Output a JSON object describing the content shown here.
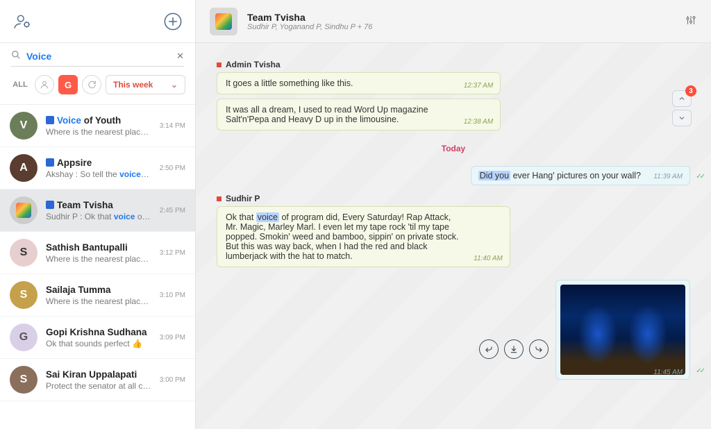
{
  "search": {
    "query": "Voice"
  },
  "filters": {
    "all_label": "ALL",
    "g_label": "G",
    "date_label": "This week"
  },
  "chats": [
    {
      "title_pre": "",
      "title_hl": "Voice",
      "title_post": " of Youth",
      "preview": "Where is the nearest place to...",
      "time": "3:14 PM",
      "group": true
    },
    {
      "title_pre": "Appsire",
      "title_hl": "",
      "title_post": "",
      "preview_pre": "Akshay  : So tell the ",
      "preview_hl": "voice",
      "preview_post": " of...",
      "time": "2:50 PM",
      "group": true
    },
    {
      "title_pre": "Team Tvisha",
      "title_hl": "",
      "title_post": "",
      "preview_pre": "Sudhir P  : Ok that ",
      "preview_hl": "voice",
      "preview_post": " of p...",
      "time": "2:45 PM",
      "group": true,
      "selected": true
    },
    {
      "title_pre": "Sathish Bantupalli",
      "preview": "Where is the nearest place to...",
      "time": "3:12 PM"
    },
    {
      "title_pre": "Sailaja Tumma",
      "preview": "Where is the nearest place to...",
      "time": "3:10 PM"
    },
    {
      "title_pre": "Gopi Krishna Sudhana",
      "preview": "Ok that sounds perfect  👍",
      "time": "3:09 PM"
    },
    {
      "title_pre": "Sai Kiran Uppalapati",
      "preview": "Protect the senator at all costs.",
      "time": "3:00 PM"
    }
  ],
  "header": {
    "group_name": "Team Tvisha",
    "members": "Sudhir P, Yoganand P, Sindhu P + 76"
  },
  "scroll_badge": "3",
  "thread": {
    "sender1": "Admin Tvisha",
    "msg1": {
      "text": "It goes a little something like this.",
      "ts": "12:37 AM"
    },
    "msg2": {
      "text": "It was all a dream, I used to read Word Up magazine Salt'n'Pepa and Heavy D up in the limousine.",
      "ts": "12:38 AM"
    },
    "divider": "Today",
    "out1": {
      "sel": "Did you",
      "rest": " ever Hang' pictures on your wall?",
      "ts": "11:39 AM"
    },
    "sender2": "Sudhir P",
    "msg3": {
      "pre": "Ok that ",
      "hl": "voice",
      "post": " of program did, Every Saturday! Rap Attack, Mr. Magic, Marley Marl. I even let my tape rock 'til my tape popped. Smokin' weed and bamboo, sippin' on private stock.  But this was way back, when I had the red and black lumberjack with the hat to match.",
      "ts": "11:40 AM"
    },
    "image_ts": "11:45 AM"
  }
}
